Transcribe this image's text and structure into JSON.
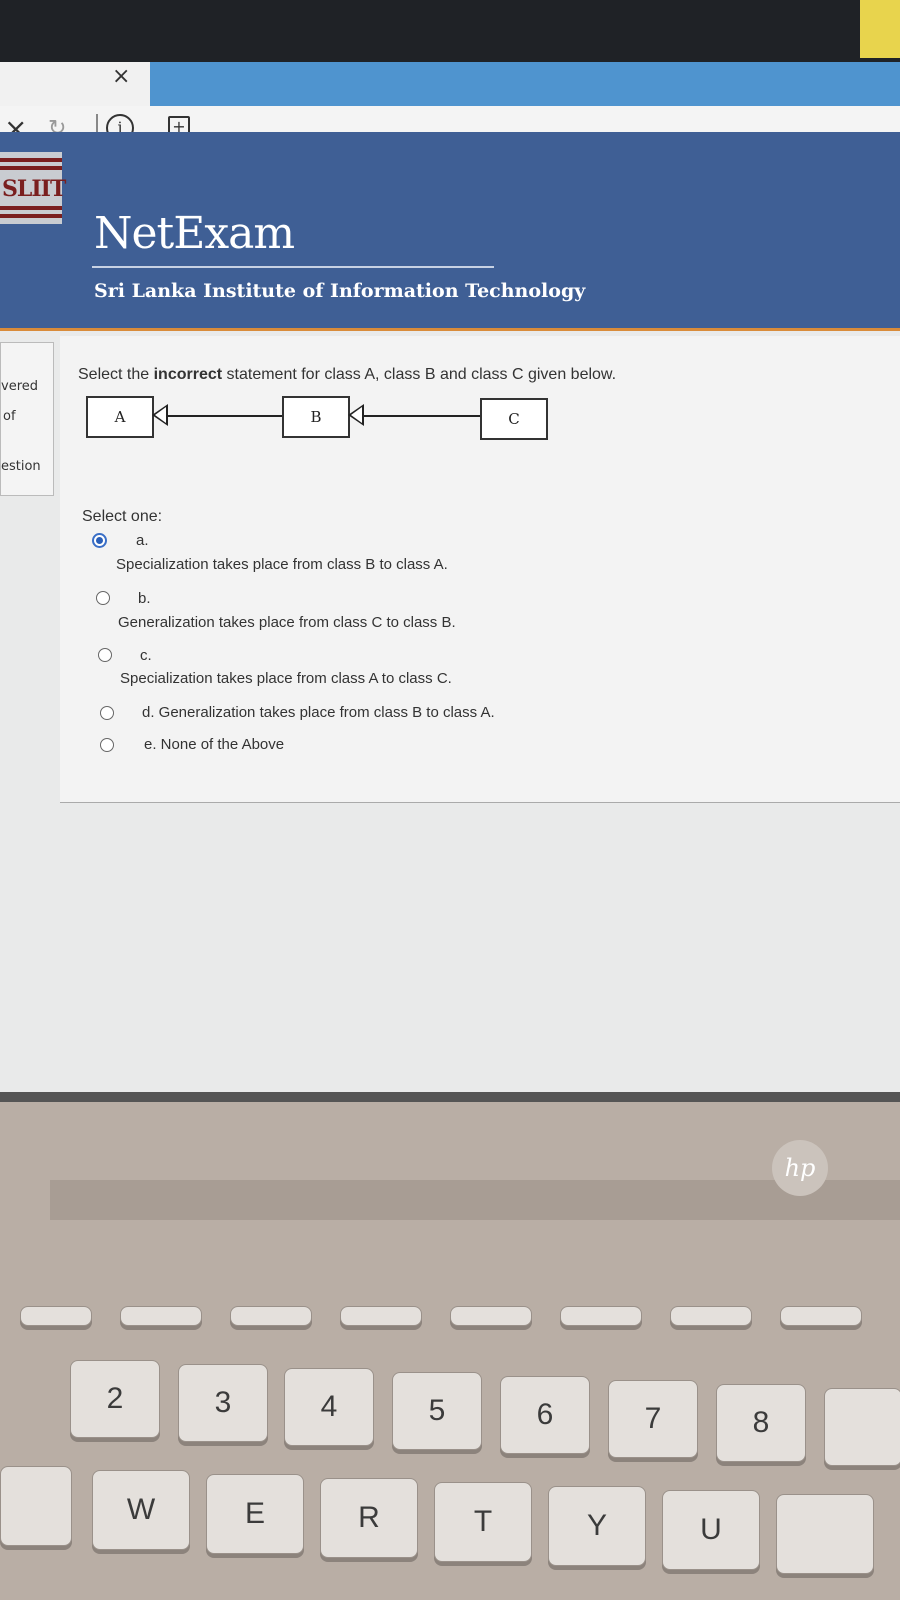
{
  "browser": {
    "tab_close_glyph": "×",
    "nav_close_glyph": "×",
    "nav_refresh_glyph": "↻",
    "info_glyph": "i",
    "plus_glyph": "+"
  },
  "header": {
    "logo_text": "SLIIT",
    "brand": "NetExam",
    "subtitle": "Sri Lanka Institute of Information Technology"
  },
  "side_panel": {
    "line1": "vered",
    "line2": "of",
    "line3": "estion"
  },
  "question": {
    "prefix": "Select the ",
    "emphasis": "incorrect",
    "suffix": " statement for class A, class B and class C given below.",
    "diagram": {
      "class_a": "A",
      "class_b": "B",
      "class_c": "C"
    },
    "select_one": "Select one:",
    "options": [
      {
        "letter": "a.",
        "text": "Specialization takes place from class B to class A.",
        "selected": true
      },
      {
        "letter": "b.",
        "text": "Generalization takes place from class C to class B.",
        "selected": false
      },
      {
        "letter": "c.",
        "text": "Specialization takes place from class A to class C.",
        "selected": false
      },
      {
        "letter": "",
        "text": "d. Generalization takes place from class B to class A.",
        "selected": false
      },
      {
        "letter": "",
        "text": "e. None of the Above",
        "selected": false
      }
    ]
  },
  "laptop": {
    "logo": "hp",
    "keys_row1": [
      "2",
      "3",
      "4",
      "5",
      "6",
      "7",
      "8"
    ],
    "keys_row1_shift": [
      "@",
      "#",
      "$",
      "%",
      "^",
      "&",
      "*"
    ],
    "keys_row2": [
      "W",
      "E",
      "R",
      "T",
      "Y",
      "U"
    ]
  }
}
